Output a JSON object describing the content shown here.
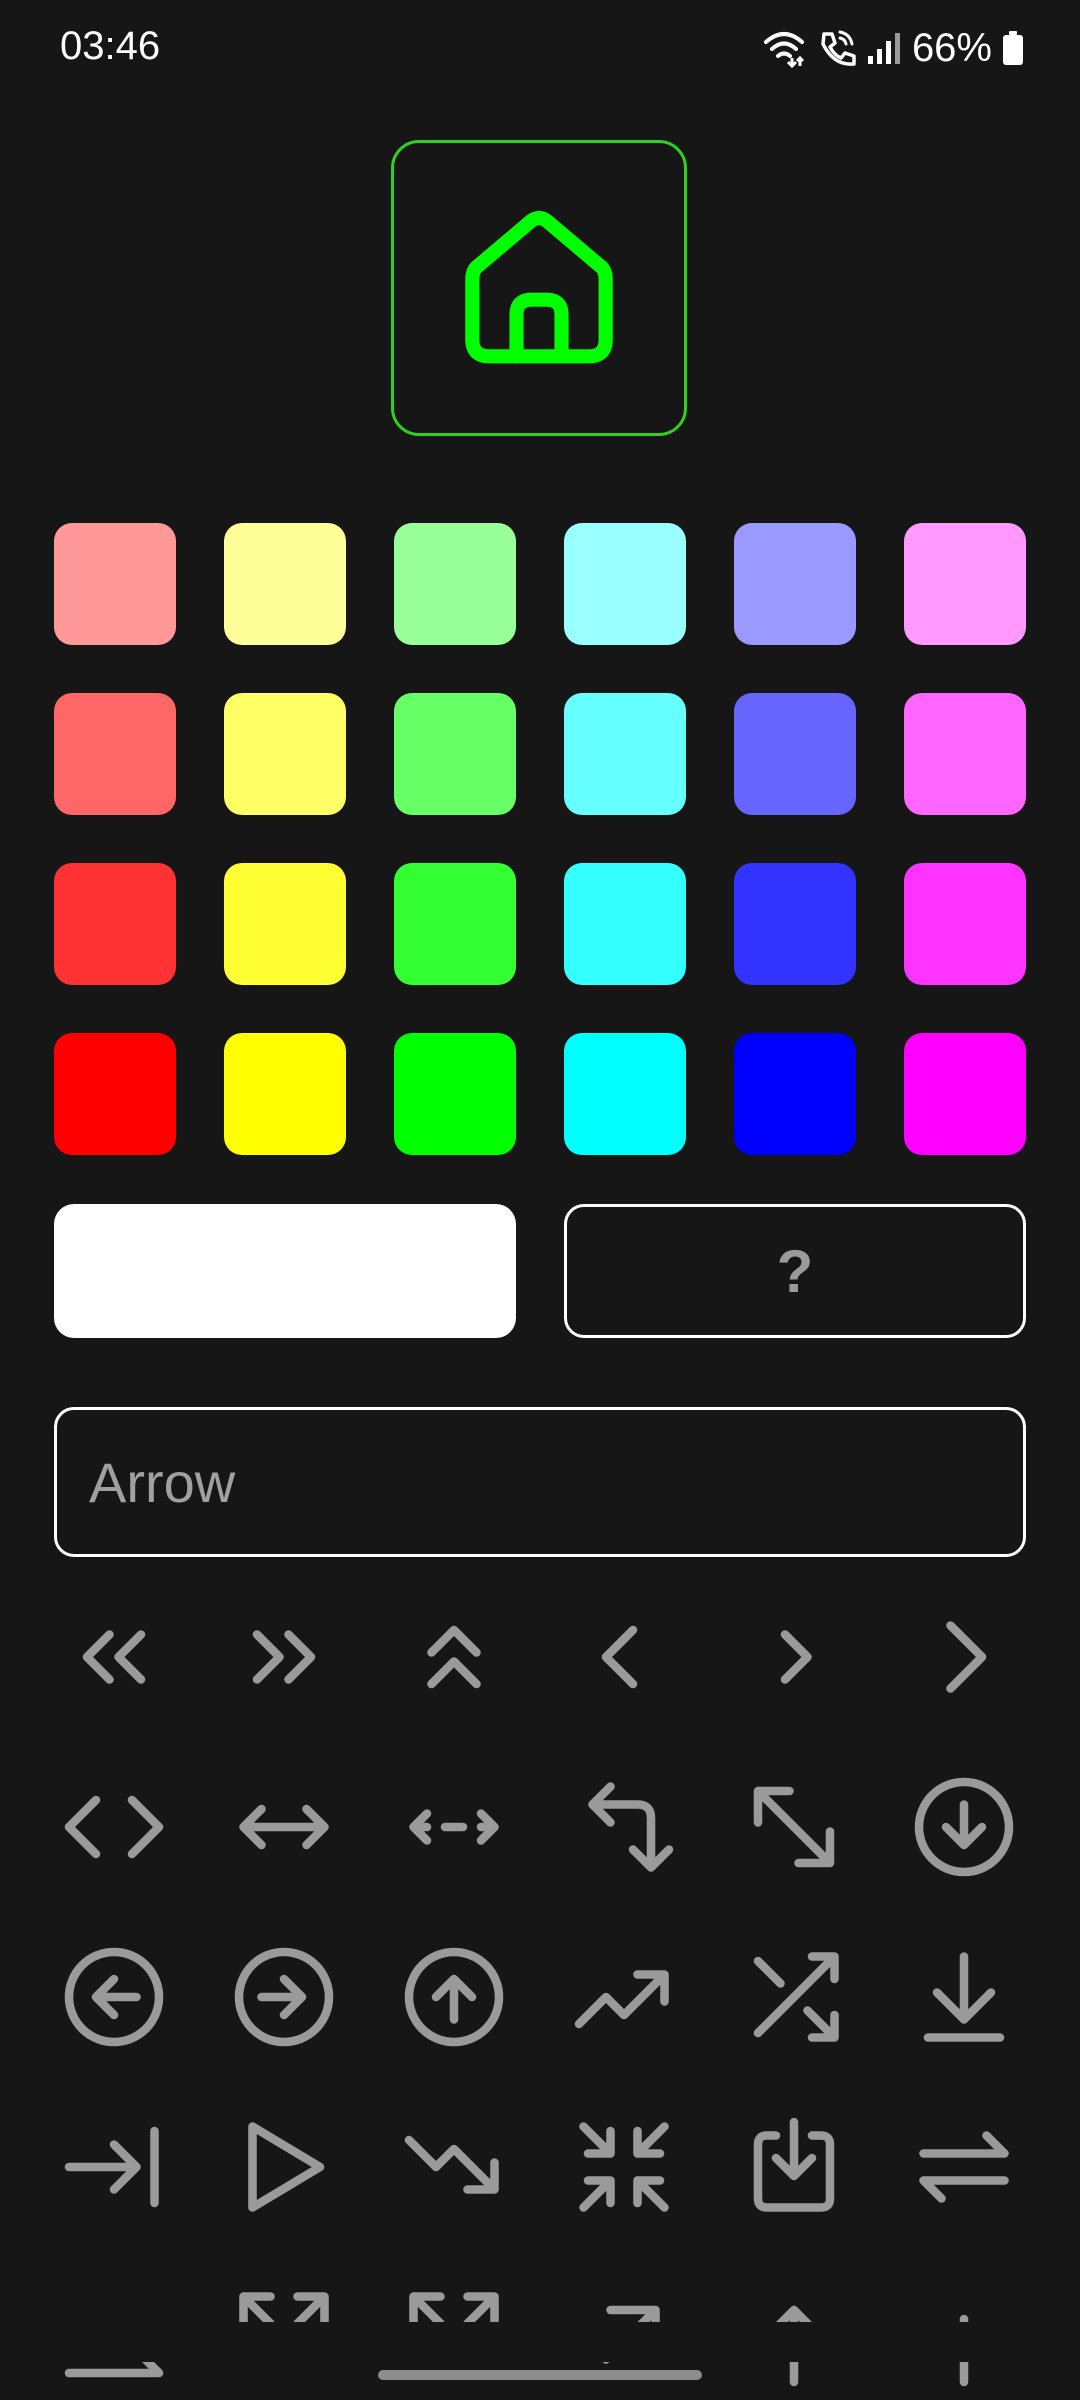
{
  "status_bar": {
    "time": "03:46",
    "battery_percent": "66%",
    "icons": [
      "wifi-calling-icon",
      "call-icon",
      "signal-icon",
      "battery-icon"
    ]
  },
  "preview": {
    "icon": "home-icon",
    "color": "#00ff00",
    "border_color": "#2fd01f"
  },
  "colors": [
    [
      "#ff9999",
      "#ffff99",
      "#99ff99",
      "#99ffff",
      "#9999ff",
      "#ff99ff"
    ],
    [
      "#ff6666",
      "#ffff66",
      "#66ff66",
      "#66ffff",
      "#6666ff",
      "#ff66ff"
    ],
    [
      "#ff3333",
      "#ffff33",
      "#33ff33",
      "#33ffff",
      "#3333ff",
      "#ff33ff"
    ],
    [
      "#ff0000",
      "#ffff00",
      "#00ff00",
      "#00ffff",
      "#0000ff",
      "#ff00ff"
    ]
  ],
  "white_color": "#ffffff",
  "help_button": {
    "label": "?"
  },
  "search": {
    "value": "Arrow"
  },
  "icons": [
    [
      "chevrons-left-icon",
      "chevrons-right-icon",
      "chevrons-up-icon",
      "chevron-left-small-icon",
      "chevron-right-small-icon",
      "chevron-right-icon"
    ],
    [
      "code-icon",
      "arrow-left-right-icon",
      "arrows-horizontal-icon",
      "corner-left-down-icon",
      "arrow-diagonal-expand-icon",
      "arrow-down-circle-icon"
    ],
    [
      "arrow-left-circle-icon",
      "arrow-right-circle-icon",
      "arrow-up-circle-icon",
      "trending-up-icon",
      "shuffle-icon",
      "download-icon"
    ],
    [
      "arrow-right-to-line-icon",
      "play-icon",
      "trending-down-icon",
      "minimize-icon",
      "import-icon",
      "arrows-exchange-icon"
    ],
    [
      "arrow-right-bottom-icon",
      "maximize-icon",
      "fullscreen-icon",
      "blank-icon",
      "arrow-up-right-icon",
      "arrow-up-icon",
      "line-icon"
    ]
  ],
  "icon_color": "#9a9a9a"
}
